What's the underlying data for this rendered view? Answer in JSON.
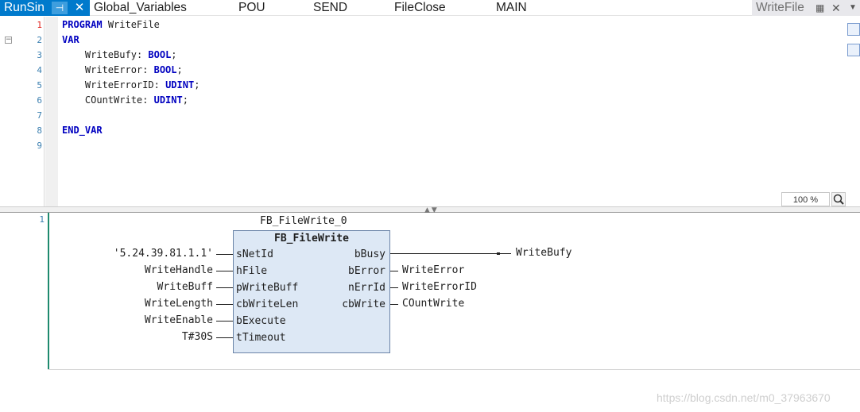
{
  "tabs": {
    "active": {
      "label": "RunSin",
      "pin_glyph": "⊣",
      "close_glyph": "✕"
    },
    "items": [
      "Global_Variables",
      "POU",
      "SEND",
      "FileClose",
      "MAIN"
    ],
    "right": {
      "label": "WriteFile"
    }
  },
  "declaration": {
    "line_numbers": [
      "1",
      "2",
      "3",
      "4",
      "5",
      "6",
      "7",
      "8",
      "9"
    ],
    "program_kw": "PROGRAM",
    "program_name": "WriteFile",
    "var_kw": "VAR",
    "vars": [
      {
        "name": "WriteBufy",
        "type": "BOOL"
      },
      {
        "name": "WriteError",
        "type": "BOOL"
      },
      {
        "name": "WriteErrorID",
        "type": "UDINT"
      },
      {
        "name": "COuntWrite",
        "type": "UDINT"
      }
    ],
    "end_var_kw": "END_VAR",
    "zoom": "100 %"
  },
  "implementation": {
    "network_number": "1",
    "instance_name": "FB_FileWrite_0",
    "block_type": "FB_FileWrite",
    "inputs": [
      {
        "pin": "sNetId",
        "arg": "'5.24.39.81.1.1'"
      },
      {
        "pin": "hFile",
        "arg": "WriteHandle"
      },
      {
        "pin": "pWriteBuff",
        "arg": "WriteBuff"
      },
      {
        "pin": "cbWriteLen",
        "arg": "WriteLength"
      },
      {
        "pin": "bExecute",
        "arg": "WriteEnable"
      },
      {
        "pin": "tTimeout",
        "arg": "T#30S"
      }
    ],
    "outputs": [
      {
        "pin": "bBusy",
        "arg": "WriteBufy"
      },
      {
        "pin": "bError",
        "arg": "WriteError"
      },
      {
        "pin": "nErrId",
        "arg": "WriteErrorID"
      },
      {
        "pin": "cbWrite",
        "arg": "COuntWrite"
      }
    ]
  },
  "watermark": "https://blog.csdn.net/m0_37963670",
  "colors": {
    "accent": "#007acc",
    "keyword": "#0000c0",
    "fb_fill": "#dde8f5",
    "network_bar": "#1f8a6e"
  }
}
